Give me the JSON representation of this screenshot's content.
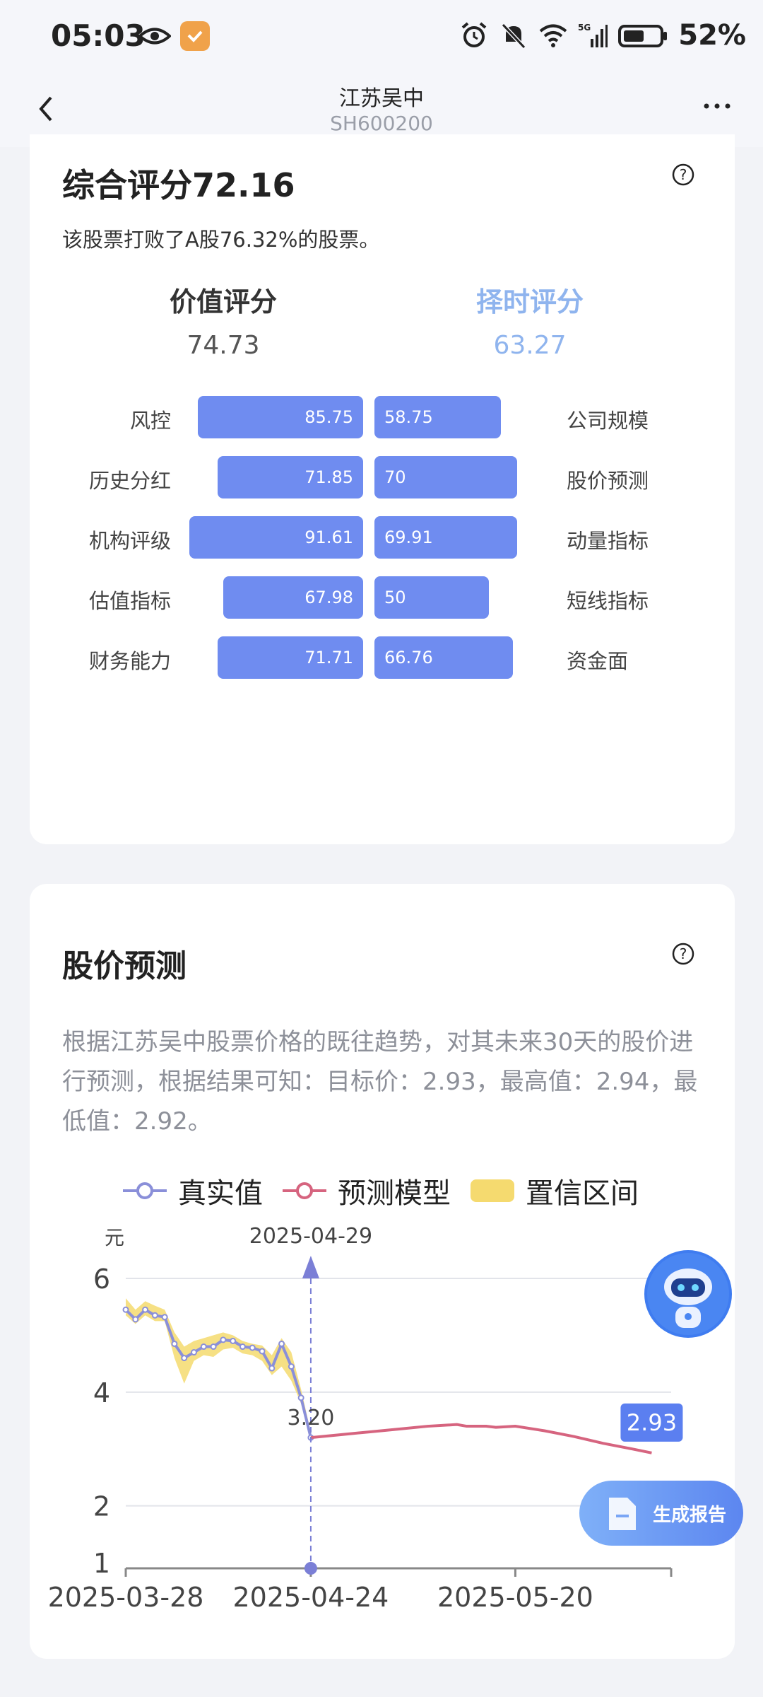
{
  "status_bar": {
    "time": "05:03",
    "battery": "52%",
    "icons": [
      "eye-icon",
      "app-badge-icon",
      "alarm-icon",
      "mute-bell-icon",
      "wifi-icon",
      "signal-5g-icon",
      "battery-icon"
    ]
  },
  "nav": {
    "title": "江苏吴中",
    "subtitle": "SH600200",
    "back_icon": "chevron-left-icon",
    "more_icon": "more-horizontal-icon"
  },
  "score_card": {
    "title": "综合评分72.16",
    "description": "该股票打败了A股76.32%的股票。",
    "left_head": "价值评分",
    "left_value": "74.73",
    "right_head": "择时评分",
    "right_value": "63.27",
    "rows": [
      {
        "left_label": "风控",
        "left_value": "85.75",
        "left_num": 85.75,
        "right_label": "公司规模",
        "right_value": "58.75",
        "right_num": 58.75
      },
      {
        "left_label": "历史分红",
        "left_value": "71.85",
        "left_num": 71.85,
        "right_label": "股价预测",
        "right_value": "70",
        "right_num": 70
      },
      {
        "left_label": "机构评级",
        "left_value": "91.61",
        "left_num": 91.61,
        "right_label": "动量指标",
        "right_value": "69.91",
        "right_num": 69.91
      },
      {
        "left_label": "估值指标",
        "left_value": "67.98",
        "left_num": 67.98,
        "right_label": "短线指标",
        "right_value": "50",
        "right_num": 50
      },
      {
        "left_label": "财务能力",
        "left_value": "71.71",
        "left_num": 71.71,
        "right_label": "资金面",
        "right_value": "66.76",
        "right_num": 66.76
      }
    ],
    "bar_color": "#6f8cf0",
    "right_head_color": "#8fb4ee"
  },
  "prediction_card": {
    "title": "股价预测",
    "description": "根据江苏吴中股票价格的既往趋势，对其未来30天的股价进行预测，根据结果可知：目标价：2.93，最高值：2.94，最低值：2.92。"
  },
  "chart_data": {
    "type": "line",
    "ylabel": "元",
    "yticks": [
      "6",
      "4",
      "2",
      "1"
    ],
    "ylim": [
      1,
      6.1
    ],
    "xticks": [
      "2025-03-28",
      "2025-04-24",
      "2025-05-20"
    ],
    "legend": [
      "真实值",
      "预测模型",
      "置信区间"
    ],
    "legend_position": "top",
    "grid": true,
    "colors": {
      "actual": "#8a8fd9",
      "predicted": "#d6647f",
      "band": "#f5da6f",
      "marker": "#7b7fd6"
    },
    "series": [
      {
        "name": "真实值",
        "x": [
          0,
          1,
          2,
          3,
          4,
          5,
          6,
          7,
          8,
          9,
          10,
          11,
          12,
          13,
          14,
          15,
          16,
          17,
          18,
          19
        ],
        "values": [
          5.45,
          5.28,
          5.45,
          5.35,
          5.32,
          4.85,
          4.6,
          4.7,
          4.8,
          4.8,
          4.92,
          4.9,
          4.8,
          4.78,
          4.72,
          4.42,
          4.85,
          4.45,
          3.9,
          3.2
        ]
      },
      {
        "name": "预测模型",
        "x": [
          19,
          22,
          25,
          28,
          31,
          34,
          35,
          37,
          38,
          40,
          43,
          46,
          49,
          52,
          54
        ],
        "values": [
          3.2,
          3.25,
          3.3,
          3.35,
          3.4,
          3.43,
          3.4,
          3.4,
          3.38,
          3.4,
          3.32,
          3.22,
          3.1,
          3.0,
          2.93
        ]
      }
    ],
    "band": {
      "name": "置信区间",
      "x": [
        0,
        1,
        2,
        3,
        4,
        5,
        6,
        7,
        8,
        9,
        10,
        11,
        12,
        13,
        14,
        15,
        16,
        17,
        18,
        19
      ],
      "upper": [
        5.65,
        5.45,
        5.6,
        5.52,
        5.45,
        5.05,
        4.8,
        4.9,
        4.95,
        5.0,
        5.05,
        5.0,
        4.9,
        4.85,
        4.82,
        4.65,
        4.95,
        4.7,
        4.05,
        3.3
      ],
      "lower": [
        5.35,
        5.2,
        5.35,
        5.25,
        5.25,
        4.6,
        4.15,
        4.55,
        4.65,
        4.62,
        4.75,
        4.78,
        4.68,
        4.65,
        4.55,
        4.3,
        4.45,
        4.2,
        3.8,
        3.15
      ]
    },
    "x_tick_positions": [
      0,
      19,
      40
    ],
    "x_max": 56,
    "cursor": {
      "x": 19,
      "date": "2025-04-29",
      "value_label": "3.20"
    },
    "end_label": "2.93"
  },
  "floating": {
    "assistant_icon": "robot-assistant-icon",
    "report_button": "生成报告",
    "report_icon": "document-icon"
  }
}
